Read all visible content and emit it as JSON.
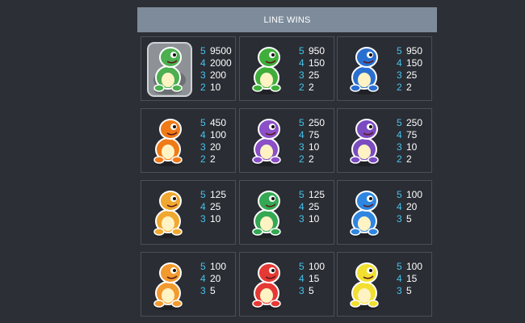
{
  "header": {
    "title": "LINE WINS"
  },
  "paytable": [
    {
      "symbol": "nest-dino-icon",
      "body": "#4caf50",
      "pays": [
        {
          "count": "5",
          "value": "9500"
        },
        {
          "count": "4",
          "value": "2000"
        },
        {
          "count": "3",
          "value": "200"
        },
        {
          "count": "2",
          "value": "10"
        }
      ]
    },
    {
      "symbol": "green-red-dino-icon",
      "body": "#3fae3a",
      "pays": [
        {
          "count": "5",
          "value": "950"
        },
        {
          "count": "4",
          "value": "150"
        },
        {
          "count": "3",
          "value": "25"
        },
        {
          "count": "2",
          "value": "2"
        }
      ]
    },
    {
      "symbol": "blue-dino-icon",
      "body": "#2a6fd0",
      "pays": [
        {
          "count": "5",
          "value": "950"
        },
        {
          "count": "4",
          "value": "150"
        },
        {
          "count": "3",
          "value": "25"
        },
        {
          "count": "2",
          "value": "2"
        }
      ]
    },
    {
      "symbol": "orange-dino-icon",
      "body": "#f07a18",
      "pays": [
        {
          "count": "5",
          "value": "450"
        },
        {
          "count": "4",
          "value": "100"
        },
        {
          "count": "3",
          "value": "20"
        },
        {
          "count": "2",
          "value": "2"
        }
      ]
    },
    {
      "symbol": "purple-egg-dino-icon",
      "body": "#8b4fc8",
      "pays": [
        {
          "count": "5",
          "value": "250"
        },
        {
          "count": "4",
          "value": "75"
        },
        {
          "count": "3",
          "value": "10"
        },
        {
          "count": "2",
          "value": "2"
        }
      ]
    },
    {
      "symbol": "purple-dino-icon",
      "body": "#7b4bc0",
      "pays": [
        {
          "count": "5",
          "value": "250"
        },
        {
          "count": "4",
          "value": "75"
        },
        {
          "count": "3",
          "value": "10"
        },
        {
          "count": "2",
          "value": "2"
        }
      ]
    },
    {
      "symbol": "yellow-dino-icon",
      "body": "#f0a830",
      "pays": [
        {
          "count": "5",
          "value": "125"
        },
        {
          "count": "4",
          "value": "25"
        },
        {
          "count": "3",
          "value": "10"
        }
      ]
    },
    {
      "symbol": "green-dino-icon",
      "body": "#34a853",
      "pays": [
        {
          "count": "5",
          "value": "125"
        },
        {
          "count": "4",
          "value": "25"
        },
        {
          "count": "3",
          "value": "10"
        }
      ]
    },
    {
      "symbol": "blue-triceratops-icon",
      "body": "#2f86e0",
      "pays": [
        {
          "count": "5",
          "value": "100"
        },
        {
          "count": "4",
          "value": "20"
        },
        {
          "count": "3",
          "value": "5"
        }
      ]
    },
    {
      "symbol": "bat-dino-icon",
      "body": "#f29a2e",
      "pays": [
        {
          "count": "5",
          "value": "100"
        },
        {
          "count": "4",
          "value": "20"
        },
        {
          "count": "3",
          "value": "5"
        }
      ]
    },
    {
      "symbol": "red-hatchling-icon",
      "body": "#e53935",
      "pays": [
        {
          "count": "5",
          "value": "100"
        },
        {
          "count": "4",
          "value": "15"
        },
        {
          "count": "3",
          "value": "5"
        }
      ]
    },
    {
      "symbol": "yellow-runner-dino-icon",
      "body": "#f2e030",
      "pays": [
        {
          "count": "5",
          "value": "100"
        },
        {
          "count": "4",
          "value": "15"
        },
        {
          "count": "3",
          "value": "5"
        }
      ]
    }
  ]
}
